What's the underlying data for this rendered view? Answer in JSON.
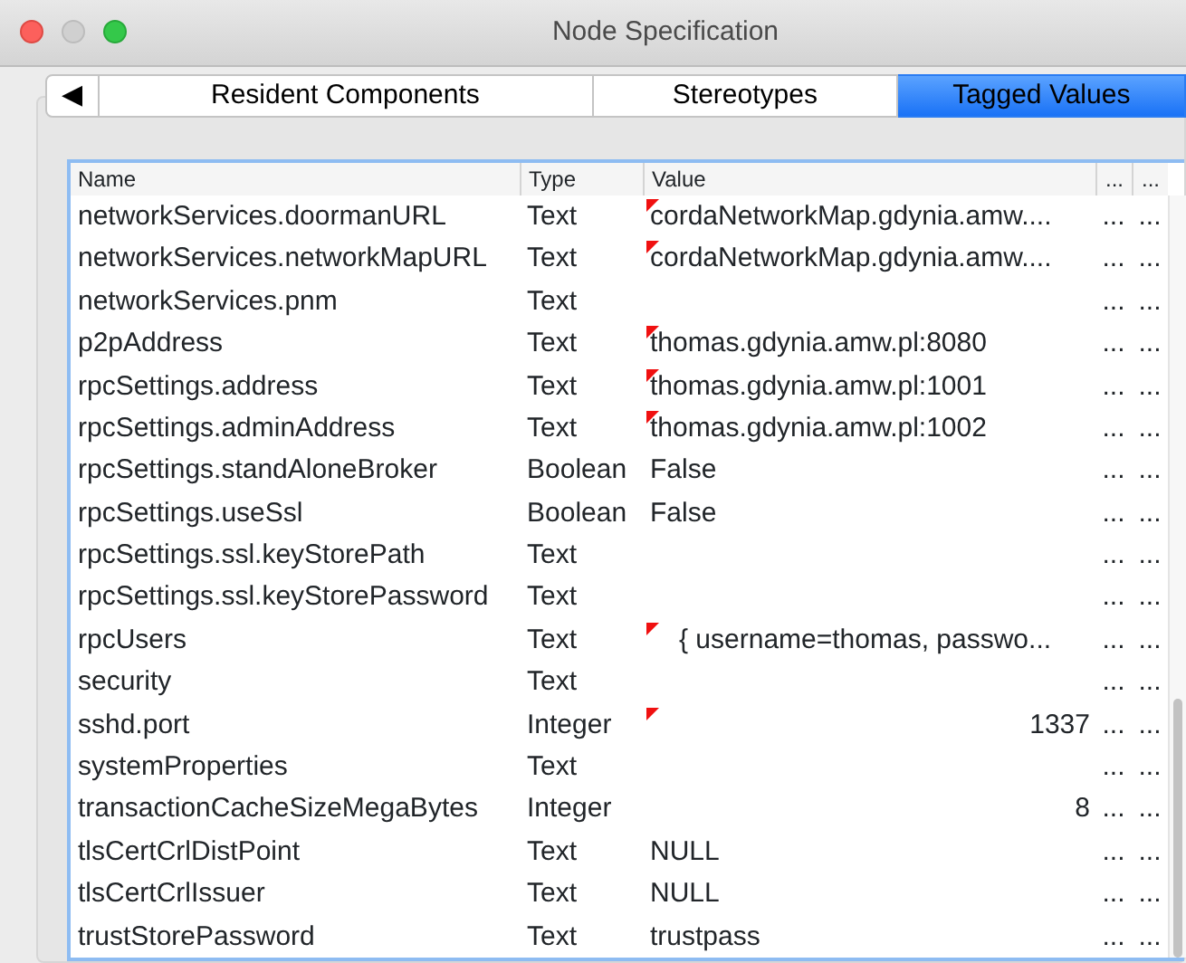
{
  "window": {
    "title": "Node Specification"
  },
  "tabs": [
    {
      "label": "◀",
      "kind": "arrow",
      "selected": false
    },
    {
      "label": "Resident Components",
      "kind": "tab",
      "selected": false
    },
    {
      "label": "Stereotypes",
      "kind": "tab",
      "selected": false
    },
    {
      "label": "Tagged Values",
      "kind": "tab",
      "selected": true
    }
  ],
  "table": {
    "columns": [
      "Name",
      "Type",
      "Value",
      "...",
      "..."
    ],
    "rows": [
      {
        "name": "networkServices.doormanURL",
        "type": "Text",
        "value": "cordaNetworkMap.gdynia.amw....",
        "kind": "text",
        "flagged": true,
        "column_4": "...",
        "column_5": "..."
      },
      {
        "name": "networkServices.networkMapURL",
        "type": "Text",
        "value": "cordaNetworkMap.gdynia.amw....",
        "kind": "text",
        "flagged": true,
        "column_4": "...",
        "column_5": "..."
      },
      {
        "name": "networkServices.pnm",
        "type": "Text",
        "kind": "text",
        "flagged": false,
        "column_4": "...",
        "column_5": "..."
      },
      {
        "name": "p2pAddress",
        "type": "Text",
        "value": "thomas.gdynia.amw.pl:8080",
        "kind": "text",
        "flagged": true,
        "column_4": "...",
        "column_5": "..."
      },
      {
        "name": "rpcSettings.address",
        "type": "Text",
        "value": "thomas.gdynia.amw.pl:1001",
        "kind": "text",
        "flagged": true,
        "column_4": "...",
        "column_5": "..."
      },
      {
        "name": "rpcSettings.adminAddress",
        "type": "Text",
        "value": "thomas.gdynia.amw.pl:1002",
        "kind": "text",
        "flagged": true,
        "column_4": "...",
        "column_5": "..."
      },
      {
        "name": "rpcSettings.standAloneBroker",
        "type": "Boolean",
        "value": "False",
        "kind": "text",
        "flagged": false,
        "column_4": "...",
        "column_5": "..."
      },
      {
        "name": "rpcSettings.useSsl",
        "type": "Boolean",
        "value": "False",
        "kind": "text",
        "flagged": false,
        "column_4": "...",
        "column_5": "..."
      },
      {
        "name": "rpcSettings.ssl.keyStorePath",
        "type": "Text",
        "kind": "text",
        "flagged": false,
        "column_4": "...",
        "column_5": "..."
      },
      {
        "name": "rpcSettings.ssl.keyStorePassword",
        "type": "Text",
        "kind": "text",
        "flagged": false,
        "column_4": "...",
        "column_5": "..."
      },
      {
        "name": "rpcUsers",
        "type": "Text",
        "value": "{ username=thomas, passwo...",
        "kind": "indented",
        "flagged": true,
        "column_4": "...",
        "column_5": "..."
      },
      {
        "name": "security",
        "type": "Text",
        "kind": "text",
        "flagged": false,
        "column_4": "...",
        "column_5": "..."
      },
      {
        "name": "sshd.port",
        "type": "Integer",
        "value": "1337",
        "kind": "number",
        "flagged": true,
        "column_4": "...",
        "column_5": "..."
      },
      {
        "name": "systemProperties",
        "type": "Text",
        "kind": "text",
        "flagged": false,
        "column_4": "...",
        "column_5": "..."
      },
      {
        "name": "transactionCacheSizeMegaBytes",
        "type": "Integer",
        "value": "8",
        "kind": "number",
        "flagged": false,
        "column_4": "...",
        "column_5": "..."
      },
      {
        "name": "tlsCertCrlDistPoint",
        "type": "Text",
        "value": "NULL",
        "kind": "text",
        "flagged": false,
        "column_4": "...",
        "column_5": "..."
      },
      {
        "name": "tlsCertCrlIssuer",
        "type": "Text",
        "value": "NULL",
        "kind": "text",
        "flagged": false,
        "column_4": "...",
        "column_5": "..."
      },
      {
        "name": "trustStorePassword",
        "type": "Text",
        "value": "trustpass",
        "kind": "text",
        "flagged": false,
        "column_4": "...",
        "column_5": "..."
      }
    ]
  }
}
